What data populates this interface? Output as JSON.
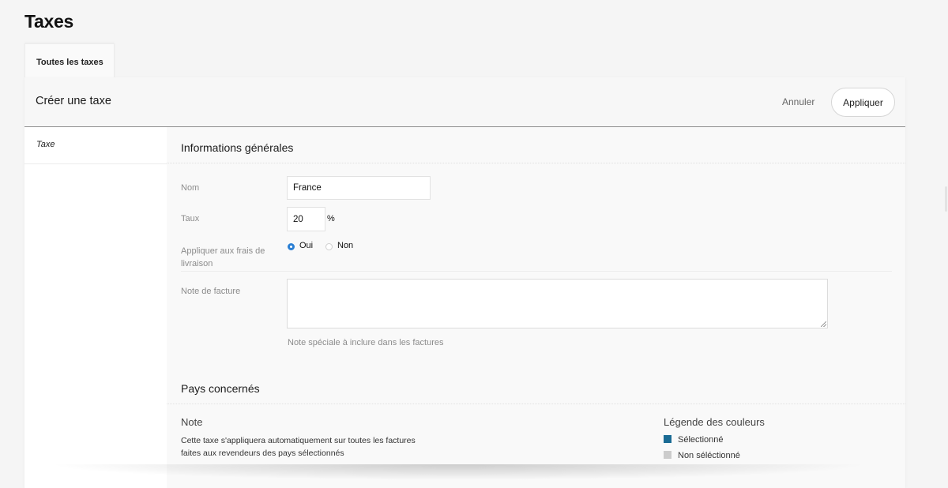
{
  "page": {
    "title": "Taxes"
  },
  "tabs": [
    {
      "label": "Toutes les taxes",
      "active": true
    }
  ],
  "form": {
    "title": "Créer une taxe",
    "cancel_label": "Annuler",
    "apply_label": "Appliquer"
  },
  "sidebar": {
    "items": [
      {
        "label": "Taxe",
        "active": true
      }
    ]
  },
  "general": {
    "title": "Informations générales",
    "name_label": "Nom",
    "name_value": "France",
    "rate_label": "Taux",
    "rate_value": "20",
    "rate_suffix": "%",
    "shipping_label": "Appliquer aux frais de livraison",
    "shipping_options": [
      {
        "label": "Oui",
        "selected": true
      },
      {
        "label": "Non",
        "selected": false
      }
    ],
    "invoice_note_label": "Note de facture",
    "invoice_note_value": "",
    "invoice_note_help": "Note spéciale à inclure dans les factures"
  },
  "countries": {
    "title": "Pays concernés",
    "note_title": "Note",
    "note_text": "Cette taxe s'appliquera automatiquement sur toutes les factures faites aux revendeurs des pays sélectionnés",
    "legend_title": "Légende des couleurs",
    "legend": [
      {
        "label": "Sélectionné",
        "color": "#1a6b94"
      },
      {
        "label": "Non séléctionné",
        "color": "#cccccc"
      }
    ]
  }
}
